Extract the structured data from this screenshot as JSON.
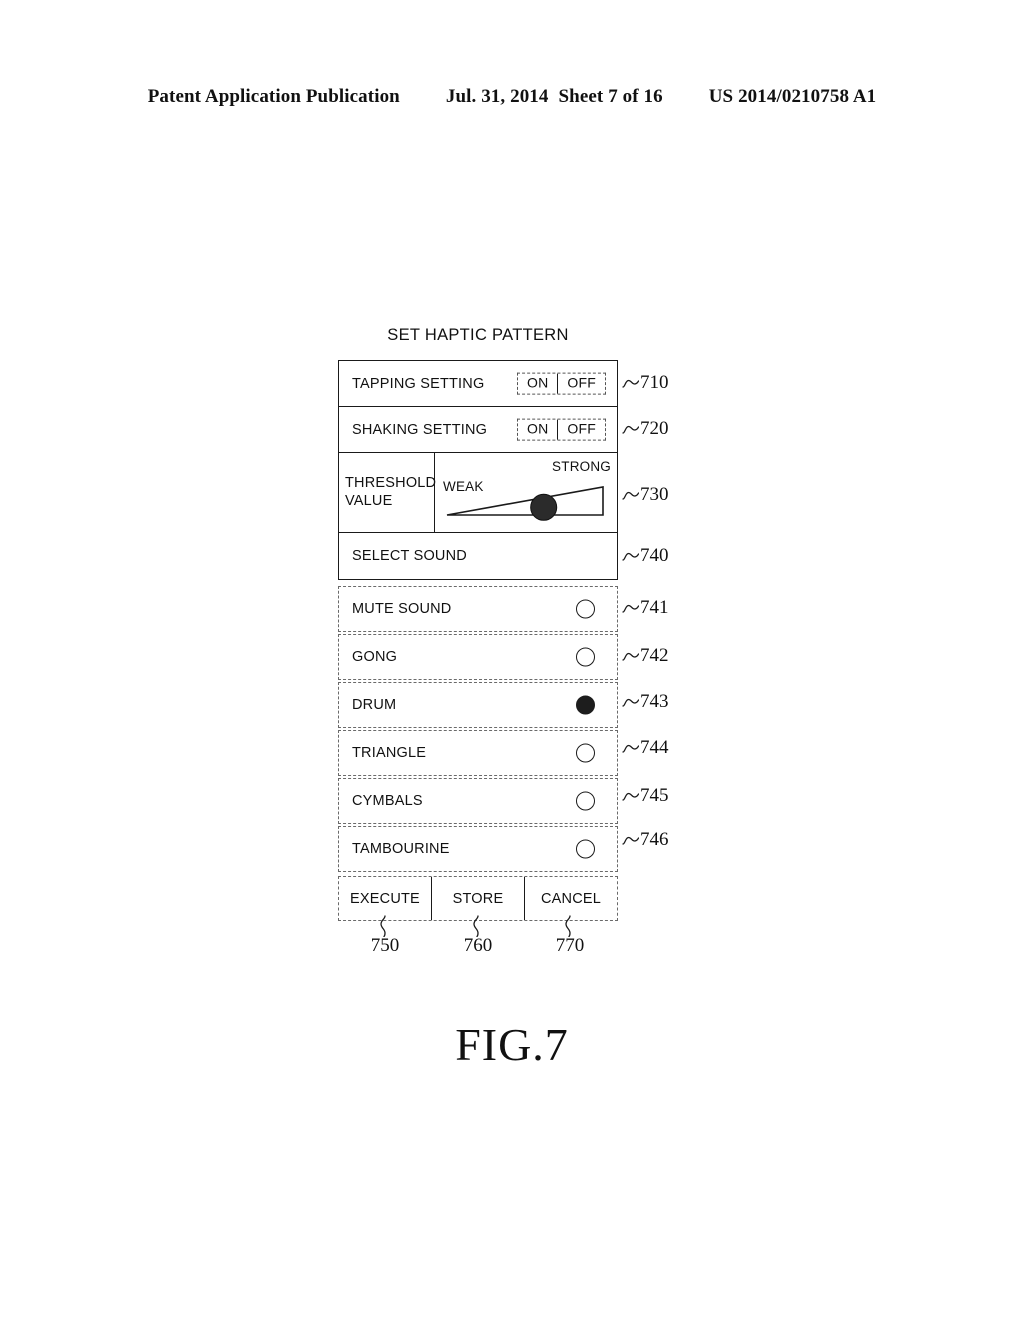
{
  "header": {
    "publication": "Patent Application Publication",
    "date": "Jul. 31, 2014",
    "sheet": "Sheet 7 of 16",
    "number": "US 2014/0210758 A1"
  },
  "figure": {
    "title": "SET HAPTIC PATTERN",
    "caption": "FIG.7"
  },
  "dialog": {
    "tapping": {
      "label": "TAPPING SETTING",
      "on_label": "ON",
      "off_label": "OFF",
      "ref": "710"
    },
    "shaking": {
      "label": "SHAKING SETTING",
      "on_label": "ON",
      "off_label": "OFF",
      "ref": "720"
    },
    "threshold": {
      "label_line1": "THRESHOLD",
      "label_line2": "VALUE",
      "weak_label": "WEAK",
      "strong_label": "STRONG",
      "thumb_position_percent": 62,
      "ref": "730"
    },
    "select_sound": {
      "label": "SELECT SOUND",
      "ref": "740"
    },
    "sound_options": [
      {
        "label": "MUTE SOUND",
        "selected": false,
        "ref": "741"
      },
      {
        "label": "GONG",
        "selected": false,
        "ref": "742"
      },
      {
        "label": "DRUM",
        "selected": true,
        "ref": "743"
      },
      {
        "label": "TRIANGLE",
        "selected": false,
        "ref": "744"
      },
      {
        "label": "CYMBALS",
        "selected": false,
        "ref": "745"
      },
      {
        "label": "TAMBOURINE",
        "selected": false,
        "ref": "746"
      }
    ],
    "buttons": [
      {
        "label": "EXECUTE",
        "ref": "750"
      },
      {
        "label": "STORE",
        "ref": "760"
      },
      {
        "label": "CANCEL",
        "ref": "770"
      }
    ]
  },
  "colors": {
    "ink": "#1a1a1a",
    "dashed": "#6a6a6a",
    "paper": "#ffffff"
  }
}
